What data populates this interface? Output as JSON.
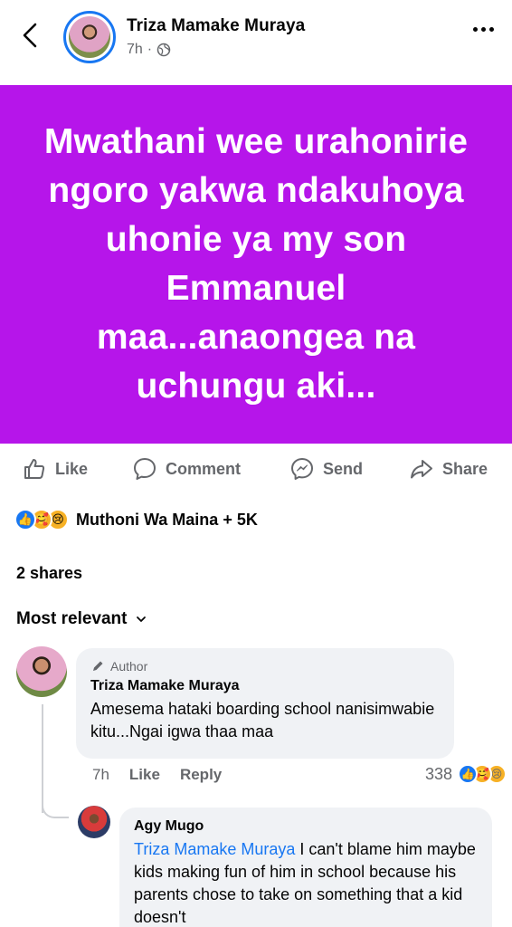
{
  "header": {
    "author": "Triza Mamake Muraya",
    "time": "7h",
    "separator": "·",
    "back_icon": "chevron-left-icon",
    "audience_icon": "globe-icon",
    "more_icon": "more-horizontal-icon"
  },
  "post": {
    "text": "Mwathani wee urahonirie ngoro yakwa ndakuhoya uhonie ya my son Emmanuel maa...anaongea na uchungu aki...",
    "background_color": "#b615ea"
  },
  "actions": {
    "like": "Like",
    "comment": "Comment",
    "send": "Send",
    "share": "Share"
  },
  "reactions": {
    "summary": "Muthoni Wa Maina + 5K",
    "icons": [
      "like-reaction-icon",
      "care-reaction-icon",
      "sad-reaction-icon"
    ]
  },
  "shares": "2 shares",
  "sort": {
    "label": "Most relevant",
    "icon": "chevron-down-icon"
  },
  "comments": [
    {
      "badge": "Author",
      "name": "Triza Mamake Muraya",
      "text": "Amesema hataki boarding school nanisimwabie kitu...Ngai igwa thaa maa",
      "time": "7h",
      "like": "Like",
      "reply": "Reply",
      "reaction_count": "338"
    },
    {
      "name": "Agy Mugo",
      "mention": "Triza Mamake Muraya",
      "text": " I can't blame him maybe kids making fun of him in school because his parents chose to take on something that a kid doesn't"
    }
  ]
}
